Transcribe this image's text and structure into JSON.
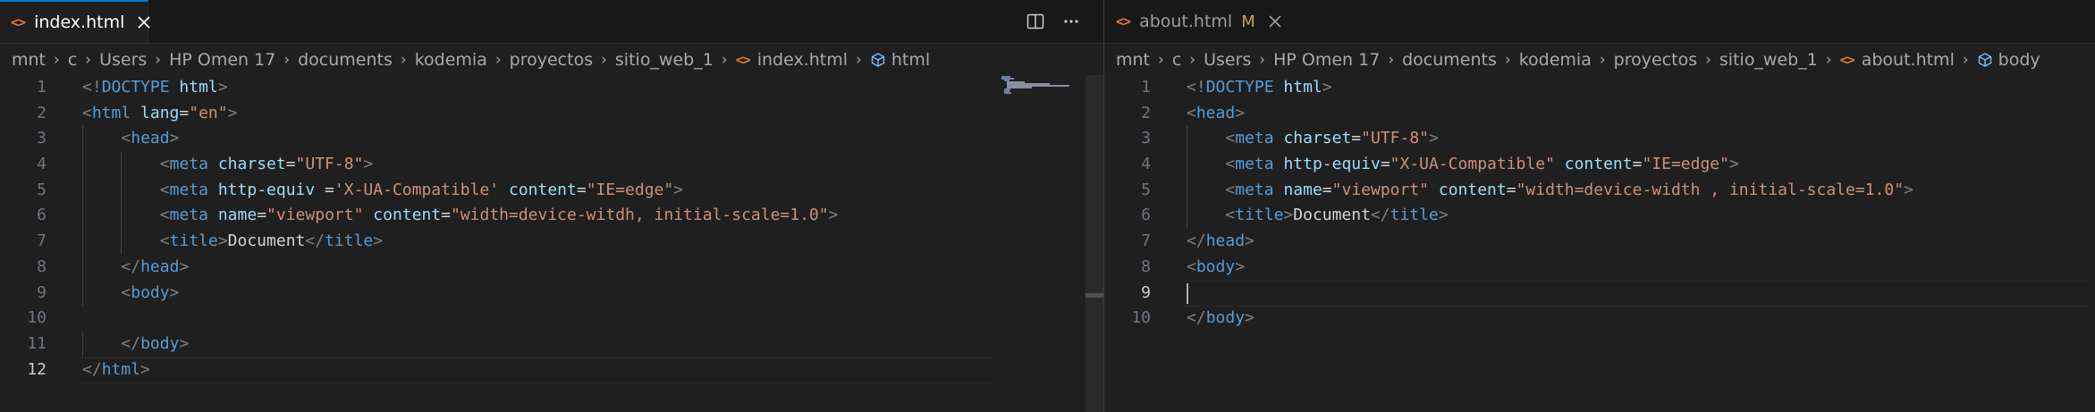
{
  "left_editor": {
    "tab": {
      "label": "index.html",
      "icon": "html-file-icon"
    },
    "breadcrumb": [
      {
        "label": "mnt"
      },
      {
        "label": "c"
      },
      {
        "label": "Users"
      },
      {
        "label": "HP Omen 17"
      },
      {
        "label": "documents"
      },
      {
        "label": "kodemia"
      },
      {
        "label": "proyectos"
      },
      {
        "label": "sitio_web_1"
      },
      {
        "label": "index.html",
        "icon": "html-file-icon"
      },
      {
        "label": "html",
        "icon": "symbol-element-icon"
      }
    ],
    "current_line": 12,
    "lines": [
      {
        "n": "1",
        "indent": 0,
        "tokens": [
          [
            "p",
            "<!"
          ],
          [
            "t",
            "DOCTYPE"
          ],
          [
            "x",
            " "
          ],
          [
            "a",
            "html"
          ],
          [
            "p",
            ">"
          ]
        ]
      },
      {
        "n": "2",
        "indent": 0,
        "tokens": [
          [
            "p",
            "<"
          ],
          [
            "t",
            "html"
          ],
          [
            "x",
            " "
          ],
          [
            "a",
            "lang"
          ],
          [
            "x",
            "="
          ],
          [
            "s",
            "\"en\""
          ],
          [
            "p",
            ">"
          ]
        ]
      },
      {
        "n": "3",
        "indent": 1,
        "tokens": [
          [
            "p",
            "<"
          ],
          [
            "t",
            "head"
          ],
          [
            "p",
            ">"
          ]
        ]
      },
      {
        "n": "4",
        "indent": 2,
        "tokens": [
          [
            "p",
            "<"
          ],
          [
            "t",
            "meta"
          ],
          [
            "x",
            " "
          ],
          [
            "a",
            "charset"
          ],
          [
            "x",
            "="
          ],
          [
            "s",
            "\"UTF-8\""
          ],
          [
            "p",
            ">"
          ]
        ]
      },
      {
        "n": "5",
        "indent": 2,
        "tokens": [
          [
            "p",
            "<"
          ],
          [
            "t",
            "meta"
          ],
          [
            "x",
            " "
          ],
          [
            "a",
            "http-equiv"
          ],
          [
            "x",
            " ="
          ],
          [
            "s",
            "'X-UA-Compatible'"
          ],
          [
            "x",
            " "
          ],
          [
            "a",
            "content"
          ],
          [
            "x",
            "="
          ],
          [
            "s",
            "\"IE=edge\""
          ],
          [
            "p",
            ">"
          ]
        ]
      },
      {
        "n": "6",
        "indent": 2,
        "tokens": [
          [
            "p",
            "<"
          ],
          [
            "t",
            "meta"
          ],
          [
            "x",
            " "
          ],
          [
            "a",
            "name"
          ],
          [
            "x",
            "="
          ],
          [
            "s",
            "\"viewport\""
          ],
          [
            "x",
            " "
          ],
          [
            "a",
            "content"
          ],
          [
            "x",
            "="
          ],
          [
            "s",
            "\"width=device-witdh, initial-scale=1.0\""
          ],
          [
            "p",
            ">"
          ]
        ]
      },
      {
        "n": "7",
        "indent": 2,
        "tokens": [
          [
            "p",
            "<"
          ],
          [
            "t",
            "title"
          ],
          [
            "p",
            ">"
          ],
          [
            "x",
            "Document"
          ],
          [
            "p",
            "</"
          ],
          [
            "t",
            "title"
          ],
          [
            "p",
            ">"
          ]
        ]
      },
      {
        "n": "8",
        "indent": 1,
        "tokens": [
          [
            "p",
            "</"
          ],
          [
            "t",
            "head"
          ],
          [
            "p",
            ">"
          ]
        ]
      },
      {
        "n": "9",
        "indent": 1,
        "tokens": [
          [
            "p",
            "<"
          ],
          [
            "t",
            "body"
          ],
          [
            "p",
            ">"
          ]
        ]
      },
      {
        "n": "10",
        "indent": 0,
        "tokens": []
      },
      {
        "n": "11",
        "indent": 1,
        "tokens": [
          [
            "p",
            "</"
          ],
          [
            "t",
            "body"
          ],
          [
            "p",
            ">"
          ]
        ]
      },
      {
        "n": "12",
        "indent": 0,
        "tokens": [
          [
            "p",
            "</"
          ],
          [
            "t",
            "html"
          ],
          [
            "p",
            ">"
          ]
        ]
      }
    ]
  },
  "right_editor": {
    "tab": {
      "label": "about.html",
      "badge": "M",
      "icon": "html-file-icon"
    },
    "breadcrumb": [
      {
        "label": "mnt"
      },
      {
        "label": "c"
      },
      {
        "label": "Users"
      },
      {
        "label": "HP Omen 17"
      },
      {
        "label": "documents"
      },
      {
        "label": "kodemia"
      },
      {
        "label": "proyectos"
      },
      {
        "label": "sitio_web_1"
      },
      {
        "label": "about.html",
        "icon": "html-file-icon"
      },
      {
        "label": "body",
        "icon": "symbol-element-icon"
      }
    ],
    "current_line": 9,
    "lines": [
      {
        "n": "1",
        "indent": 0,
        "tokens": [
          [
            "p",
            "<!"
          ],
          [
            "t",
            "DOCTYPE"
          ],
          [
            "x",
            " "
          ],
          [
            "a",
            "html"
          ],
          [
            "p",
            ">"
          ]
        ]
      },
      {
        "n": "2",
        "indent": 0,
        "tokens": [
          [
            "p",
            "<"
          ],
          [
            "t",
            "head"
          ],
          [
            "p",
            ">"
          ]
        ]
      },
      {
        "n": "3",
        "indent": 1,
        "tokens": [
          [
            "p",
            "<"
          ],
          [
            "t",
            "meta"
          ],
          [
            "x",
            " "
          ],
          [
            "a",
            "charset"
          ],
          [
            "x",
            "="
          ],
          [
            "s",
            "\"UTF-8\""
          ],
          [
            "p",
            ">"
          ]
        ]
      },
      {
        "n": "4",
        "indent": 1,
        "tokens": [
          [
            "p",
            "<"
          ],
          [
            "t",
            "meta"
          ],
          [
            "x",
            " "
          ],
          [
            "a",
            "http-equiv"
          ],
          [
            "x",
            "="
          ],
          [
            "s",
            "\"X-UA-Compatible\""
          ],
          [
            "x",
            " "
          ],
          [
            "a",
            "content"
          ],
          [
            "x",
            "="
          ],
          [
            "s",
            "\"IE=edge\""
          ],
          [
            "p",
            ">"
          ]
        ]
      },
      {
        "n": "5",
        "indent": 1,
        "tokens": [
          [
            "p",
            "<"
          ],
          [
            "t",
            "meta"
          ],
          [
            "x",
            " "
          ],
          [
            "a",
            "name"
          ],
          [
            "x",
            "="
          ],
          [
            "s",
            "\"viewport\""
          ],
          [
            "x",
            " "
          ],
          [
            "a",
            "content"
          ],
          [
            "x",
            "="
          ],
          [
            "s",
            "\"width=device-width , initial-scale=1.0\""
          ],
          [
            "p",
            ">"
          ]
        ]
      },
      {
        "n": "6",
        "indent": 1,
        "tokens": [
          [
            "p",
            "<"
          ],
          [
            "t",
            "title"
          ],
          [
            "p",
            ">"
          ],
          [
            "x",
            "Document"
          ],
          [
            "p",
            "</"
          ],
          [
            "t",
            "title"
          ],
          [
            "p",
            ">"
          ]
        ]
      },
      {
        "n": "7",
        "indent": 0,
        "tokens": [
          [
            "p",
            "</"
          ],
          [
            "t",
            "head"
          ],
          [
            "p",
            ">"
          ]
        ]
      },
      {
        "n": "8",
        "indent": 0,
        "tokens": [
          [
            "p",
            "<"
          ],
          [
            "t",
            "body"
          ],
          [
            "p",
            ">"
          ]
        ]
      },
      {
        "n": "9",
        "indent": 0,
        "tokens": []
      },
      {
        "n": "10",
        "indent": 0,
        "tokens": [
          [
            "p",
            "</"
          ],
          [
            "t",
            "body"
          ],
          [
            "p",
            ">"
          ]
        ]
      }
    ]
  },
  "editor_actions": [
    {
      "icon": "split-editor-icon"
    },
    {
      "icon": "more-actions-icon"
    }
  ],
  "theme": {
    "background": "#1f1f1f",
    "tabbar": "#181818",
    "accent": "#0078d4",
    "tag": "#569cd6",
    "attribute": "#9cdcfe",
    "string": "#ce9178",
    "punctuation": "#808080",
    "text": "#d4d4d4",
    "html_icon": "#e37933",
    "modified_badge": "#c5a34f"
  }
}
